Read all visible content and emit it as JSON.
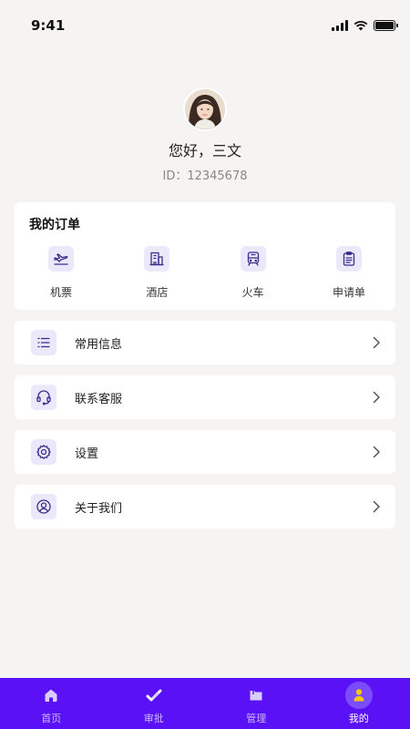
{
  "status_bar": {
    "time": "9:41"
  },
  "profile": {
    "greeting": "您好，三文",
    "id_text": "ID：12345678"
  },
  "orders": {
    "title": "我的订单",
    "items": [
      {
        "label": "机票",
        "icon": "plane-icon"
      },
      {
        "label": "酒店",
        "icon": "hotel-icon"
      },
      {
        "label": "火车",
        "icon": "train-icon"
      },
      {
        "label": "申请单",
        "icon": "clipboard-icon"
      }
    ]
  },
  "menu": [
    {
      "label": "常用信息",
      "icon": "list-icon"
    },
    {
      "label": "联系客服",
      "icon": "headset-icon"
    },
    {
      "label": "设置",
      "icon": "gear-icon"
    },
    {
      "label": "关于我们",
      "icon": "user-circle-icon"
    }
  ],
  "tabs": [
    {
      "label": "首页",
      "icon": "home-icon"
    },
    {
      "label": "审批",
      "icon": "approve-icon"
    },
    {
      "label": "管理",
      "icon": "folder-icon"
    },
    {
      "label": "我的",
      "icon": "person-icon",
      "active": true
    }
  ],
  "colors": {
    "accent": "#5a11f6",
    "icon_bg": "#ece8fb",
    "icon_stroke": "#3a2c8c",
    "background": "#f5f4f2",
    "active_person": "#f5c518"
  }
}
